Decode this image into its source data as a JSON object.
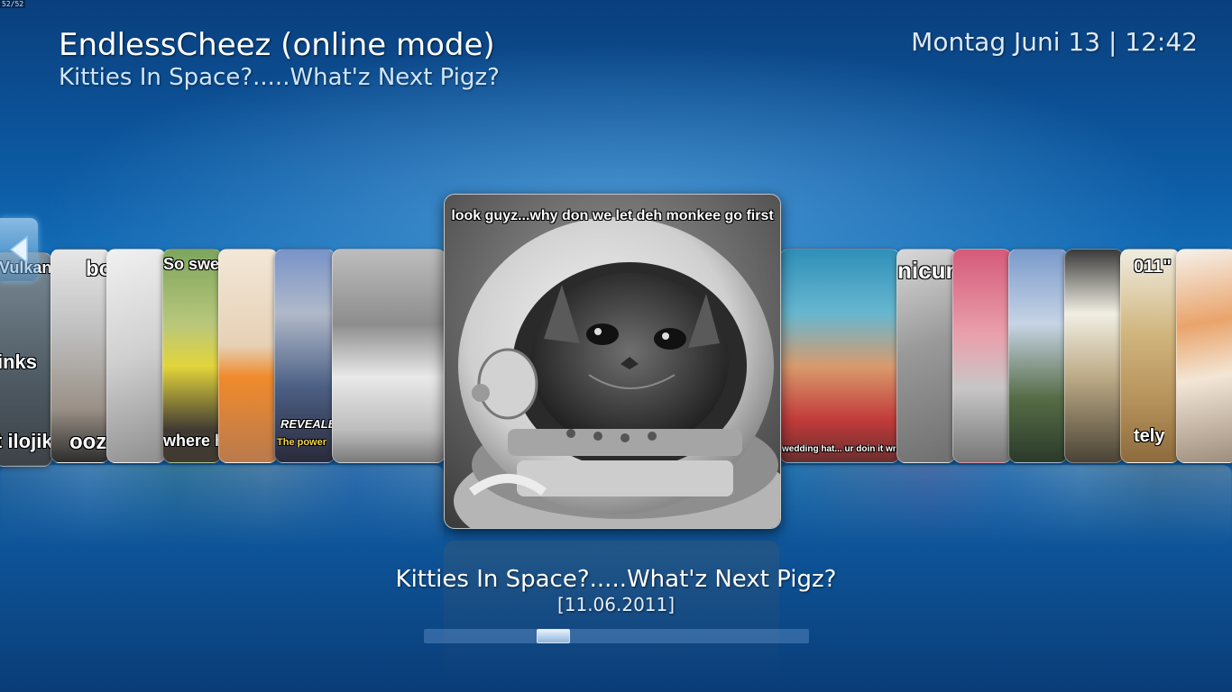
{
  "corner_tag": "52/52",
  "header": {
    "title": "EndlessCheez (online mode)",
    "subtitle": "Kitties In Space?.....What'z Next Pigz?"
  },
  "clock": {
    "text": "Montag Juni 13 | 12:42"
  },
  "nav": {
    "left_icon": "left-arrow-icon"
  },
  "carousel": {
    "left_cards": [
      {
        "caption_top": "Vulkan",
        "caption_mid": "inks",
        "caption_bottom": "t ilojik"
      },
      {
        "caption_top": "bo",
        "caption_bottom": "ooze"
      },
      {
        "caption_top": "",
        "caption_bottom": ""
      },
      {
        "caption_top": "So sweet",
        "caption_bottom": "where ha"
      },
      {
        "caption_top": "",
        "caption_bottom": ""
      },
      {
        "caption_top": "",
        "caption_banner": "REVEALE",
        "caption_bottom": "The power"
      },
      {
        "caption_top": "",
        "caption_bottom": ""
      }
    ],
    "focused": {
      "caption": "look guyz...why don we let deh monkee go first"
    },
    "right_cards": [
      {
        "caption_top": "",
        "caption_bottom": "wedding hat... ur doin it wrong"
      },
      {
        "caption_top": "nicure",
        "caption_bottom": ""
      },
      {
        "caption_top": "",
        "caption_bottom": ""
      },
      {
        "caption_top": "",
        "caption_bottom": ""
      },
      {
        "caption_top": "",
        "caption_bottom": ""
      },
      {
        "caption_top": "011\"",
        "caption_bottom": "tely"
      },
      {
        "caption_top": "",
        "caption_bottom": ""
      }
    ]
  },
  "selected_item": {
    "title": "Kitties In Space?.....What'z Next Pigz?",
    "date": "[11.06.2011]"
  },
  "scroll": {
    "position_fraction": 0.32
  },
  "colors": {
    "background_top": "#0a3f7d",
    "background_mid": "#1b7fc7",
    "accent": "#cfe5fb"
  }
}
